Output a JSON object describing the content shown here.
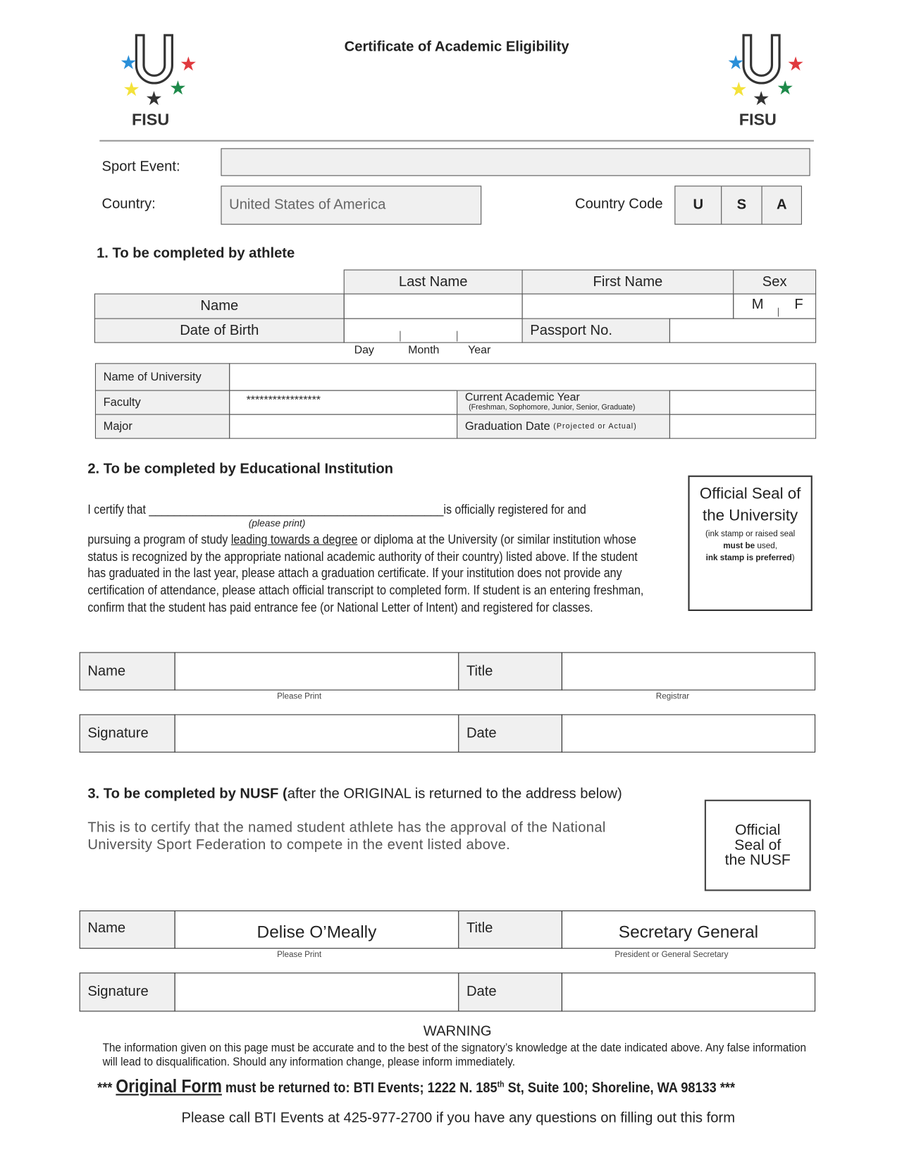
{
  "header": {
    "title": "Certificate of Academic Eligibility",
    "logo_text": "FISU"
  },
  "event": {
    "sport_event_label": "Sport Event:",
    "sport_event_value": "",
    "country_label": "Country:",
    "country_value": "United States of America",
    "country_code_label": "Country Code",
    "country_code": [
      "U",
      "S",
      "A"
    ]
  },
  "section1": {
    "title": "1. To be completed by athlete",
    "col_last": "Last Name",
    "col_first": "First Name",
    "col_sex": "Sex",
    "row_name": "Name",
    "row_dob": "Date of Birth",
    "sex_m": "M",
    "sex_f": "F",
    "passport": "Passport No.",
    "day": "Day",
    "month": "Month",
    "year": "Year",
    "university": "Name of University",
    "faculty": "Faculty",
    "faculty_value": "*****************",
    "major": "Major",
    "academic_year": "Current Academic Year",
    "academic_year_hint": "(Freshman, Sophomore, Junior, Senior, Graduate)",
    "grad_date": "Graduation Date",
    "grad_date_hint": "(Projected or Actual)"
  },
  "section2": {
    "title": "2. To be completed by Educational Institution",
    "certify_prefix": "I certify that",
    "certify_blank": "_______________________________________________",
    "certify_suffix": "is officially registered for and",
    "please_print": "(please print)",
    "p_start": "pursuing a program of study ",
    "p_underline": "leading towards a degree",
    "p_rest": " or diploma at the University (or similar institution whose status is recognized by the appropriate national academic authority of their country) listed above. If the student has graduated in the last year, please attach a graduation certificate. If your institution does not provide any certification of attendance, please attach official transcript to completed form. If student is an entering freshman, confirm that the student has paid entrance fee (or National Letter of Intent) and registered for classes.",
    "seal_title": "Official Seal of the University",
    "seal_note1": "(ink stamp or raised seal",
    "seal_note_bold": "must be",
    "seal_note2": " used,",
    "seal_note3": "ink stamp is preferred",
    "seal_note4": ")",
    "name_label": "Name",
    "name_value": "",
    "name_hint": "Please Print",
    "title_label": "Title",
    "title_value": "",
    "title_hint": "Registrar",
    "signature_label": "Signature",
    "date_label": "Date"
  },
  "section3": {
    "title_bold": "3. To be completed by NUSF (",
    "title_rest": "after the ORIGINAL is returned to the address below)",
    "text": "This is to certify that the named student athlete has the approval of the National University Sport Federation to compete in the event listed above.",
    "seal": "Official Seal of the NUSF",
    "name_label": "Name",
    "name_value": "Delise O’Meally",
    "name_hint": "Please Print",
    "title_label": "Title",
    "title_value": "Secretary General",
    "title_hint": "President or General Secretary",
    "signature_label": "Signature",
    "date_label": "Date"
  },
  "footer": {
    "warning_title": "WARNING",
    "warning_text": "The information given on this page must be accurate and to the best of the signatory’s knowledge at the date indicated above. Any false information will lead to disqualification.  Should any information change, please inform immediately.",
    "stars": "***",
    "original_form": "Original Form",
    "return_text": " must be returned to: BTI Events; 1222 N. 185",
    "sup": "th",
    "return_text2": " St, Suite 100; Shoreline, WA  98133 ***",
    "call": "Please call BTI Events at 425-977-2700 if you have any questions on filling out this form"
  },
  "colors": {
    "star_blue": "#2a8fd8",
    "star_red": "#e0393e",
    "star_yellow": "#f4e23a",
    "star_green": "#1e8a4a",
    "star_black": "#333333",
    "field_gray": "#f0f0f0"
  }
}
